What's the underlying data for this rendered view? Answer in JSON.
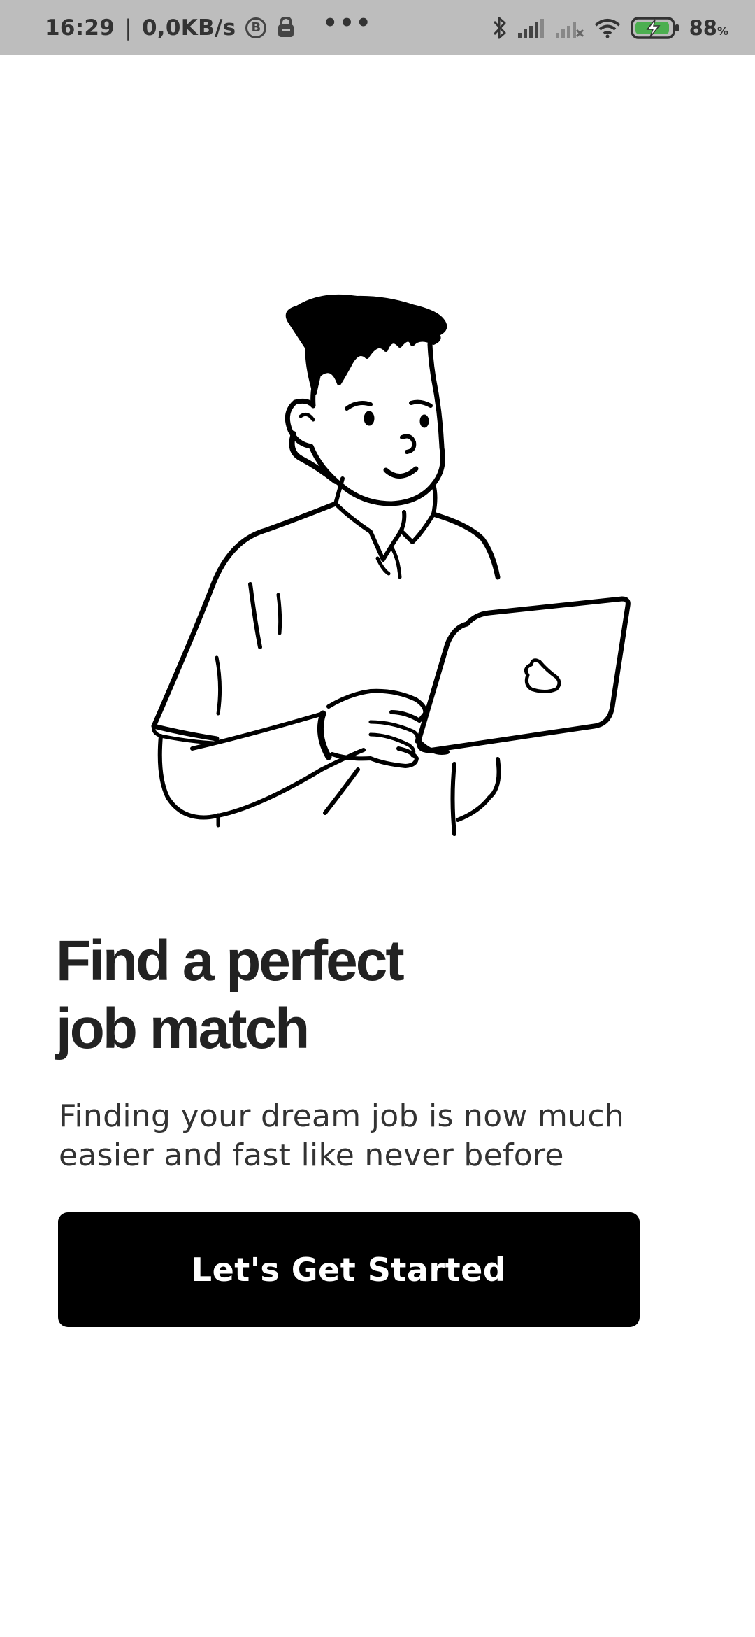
{
  "status_bar": {
    "time": "16:29",
    "network_speed": "0,0KB/s",
    "b_badge": "B",
    "more": "•••",
    "battery_level": "88",
    "battery_unit": "%",
    "icons": [
      "b-circle-icon",
      "vpn-icon",
      "more-dots-icon",
      "bluetooth-icon",
      "signal-icon",
      "signal-no-service-icon",
      "wifi-icon",
      "battery-charging-icon"
    ]
  },
  "illustration": {
    "name": "man-with-laptop-illustration"
  },
  "onboarding": {
    "headline_line1": "Find a perfect",
    "headline_line2": "job match",
    "subtitle_line1": "Finding your dream job is now much",
    "subtitle_line2": "easier and fast like never before",
    "cta_label": "Let's Get Started"
  }
}
